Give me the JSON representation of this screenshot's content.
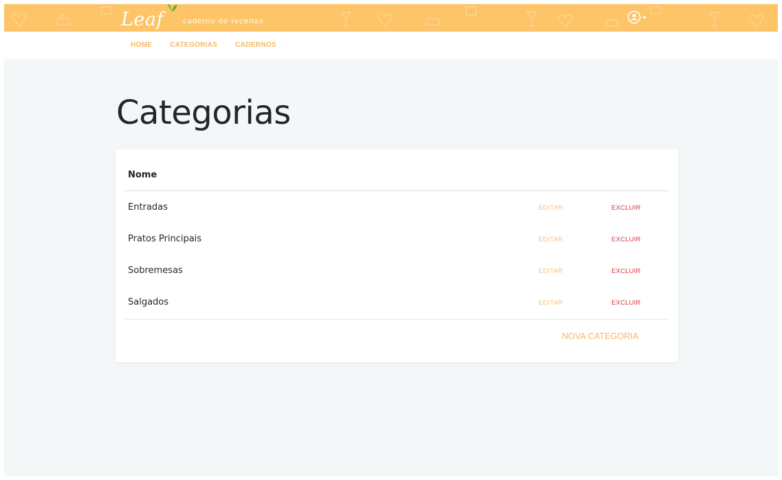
{
  "brand": {
    "name": "Leaf",
    "tagline": "caderno de receitas"
  },
  "nav": {
    "items": [
      {
        "label": "HOME"
      },
      {
        "label": "CATEGORIAS"
      },
      {
        "label": "CADERNOS"
      }
    ]
  },
  "page": {
    "title": "Categorias"
  },
  "table": {
    "column_header": "Nome",
    "rows": [
      {
        "name": "Entradas",
        "edit_label": "EDITAR",
        "delete_label": "EXCLUIR"
      },
      {
        "name": "Pratos Principais",
        "edit_label": "EDITAR",
        "delete_label": "EXCLUIR"
      },
      {
        "name": "Sobremesas",
        "edit_label": "EDITAR",
        "delete_label": "EXCLUIR"
      },
      {
        "name": "Salgados",
        "edit_label": "EDITAR",
        "delete_label": "EXCLUIR"
      }
    ],
    "new_label": "NOVA CATEGORIA"
  },
  "icons": {
    "user": "account-circle-icon",
    "leaf": "leaf-icon",
    "dropdown": "caret-down-icon"
  },
  "colors": {
    "header_bg": "#fdc468",
    "accent": "#f6b95e",
    "danger": "#d8333f",
    "page_bg": "#f4f7f8"
  }
}
